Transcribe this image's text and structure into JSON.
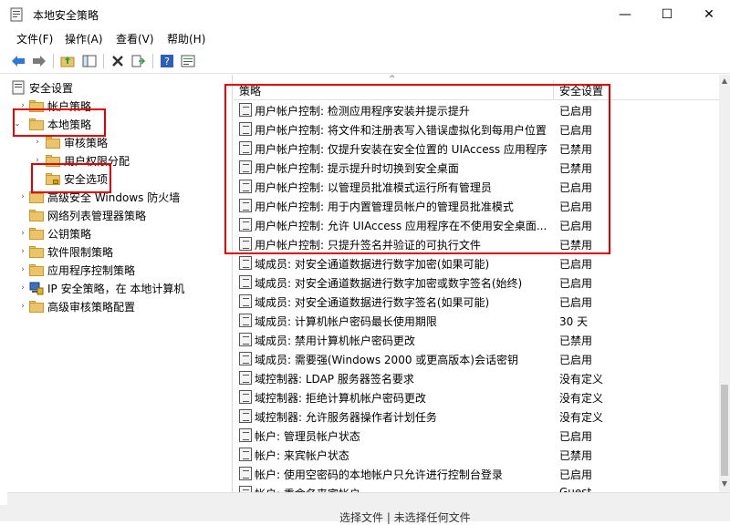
{
  "window": {
    "title": "本地安全策略",
    "minimize": "—",
    "maximize": "☐",
    "close": "✕"
  },
  "menu": [
    "文件(F)",
    "操作(A)",
    "查看(V)",
    "帮助(H)"
  ],
  "toolbar": {
    "icons": [
      "back-arrow",
      "forward-arrow",
      "up-folder",
      "show-hide-tree",
      "delete",
      "export-list",
      "help",
      "properties"
    ]
  },
  "tree": {
    "root": "安全设置",
    "items": [
      {
        "label": "帐户策略"
      },
      {
        "label": "本地策略"
      },
      {
        "label": "审核策略"
      },
      {
        "label": "用户权限分配"
      },
      {
        "label": "安全选项"
      },
      {
        "label": "高级安全 Windows 防火墙"
      },
      {
        "label": "网络列表管理器策略"
      },
      {
        "label": "公钥策略"
      },
      {
        "label": "软件限制策略"
      },
      {
        "label": "应用程序控制策略"
      },
      {
        "label": "IP 安全策略，在 本地计算机"
      },
      {
        "label": "高级审核策略配置"
      }
    ]
  },
  "list": {
    "header": {
      "policy": "策略",
      "setting": "安全设置"
    },
    "rows": [
      {
        "policy": "用户帐户控制: 检测应用程序安装并提示提升",
        "setting": "已启用"
      },
      {
        "policy": "用户帐户控制: 将文件和注册表写入错误虚拟化到每用户位置",
        "setting": "已启用"
      },
      {
        "policy": "用户帐户控制: 仅提升安装在安全位置的 UIAccess 应用程序",
        "setting": "已禁用"
      },
      {
        "policy": "用户帐户控制: 提示提升时切换到安全桌面",
        "setting": "已禁用"
      },
      {
        "policy": "用户帐户控制: 以管理员批准模式运行所有管理员",
        "setting": "已启用"
      },
      {
        "policy": "用户帐户控制: 用于内置管理员帐户的管理员批准模式",
        "setting": "已启用"
      },
      {
        "policy": "用户帐户控制: 允许 UIAccess 应用程序在不使用安全桌面...",
        "setting": "已启用"
      },
      {
        "policy": "用户帐户控制: 只提升签名并验证的可执行文件",
        "setting": "已禁用"
      },
      {
        "policy": "域成员: 对安全通道数据进行数字加密(如果可能)",
        "setting": "已启用"
      },
      {
        "policy": "域成员: 对安全通道数据进行数字加密或数字签名(始终)",
        "setting": "已启用"
      },
      {
        "policy": "域成员: 对安全通道数据进行数字签名(如果可能)",
        "setting": "已启用"
      },
      {
        "policy": "域成员: 计算机帐户密码最长使用期限",
        "setting": "30 天"
      },
      {
        "policy": "域成员: 禁用计算机帐户密码更改",
        "setting": "已禁用"
      },
      {
        "policy": "域成员: 需要强(Windows 2000 或更高版本)会话密钥",
        "setting": "已启用"
      },
      {
        "policy": "域控制器: LDAP 服务器签名要求",
        "setting": "没有定义"
      },
      {
        "policy": "域控制器: 拒绝计算机帐户密码更改",
        "setting": "没有定义"
      },
      {
        "policy": "域控制器: 允许服务器操作者计划任务",
        "setting": "没有定义"
      },
      {
        "policy": "帐户: 管理员帐户状态",
        "setting": "已启用"
      },
      {
        "policy": "帐户: 来宾帐户状态",
        "setting": "已禁用"
      },
      {
        "policy": "帐户: 使用空密码的本地帐户只允许进行控制台登录",
        "setting": "已启用"
      },
      {
        "policy": "帐户: 重命名来宾帐户",
        "setting": "Guest"
      }
    ]
  },
  "status": {
    "text": "选择文件 | 未选择任何文件"
  },
  "colors": {
    "annotation_red": "#e00000",
    "folder": "#e9c46a"
  }
}
